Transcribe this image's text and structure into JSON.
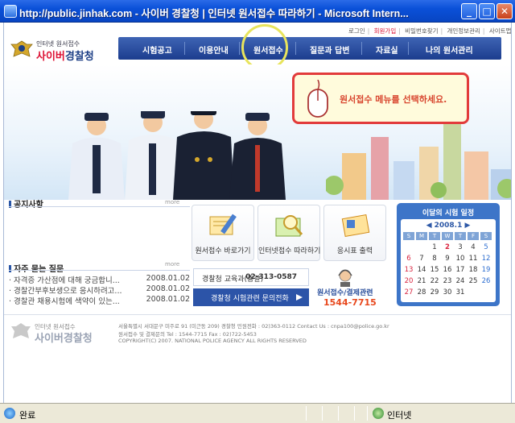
{
  "window": {
    "title": "http://public.jinhak.com - 사이버 경찰청 | 인터넷 원서접수 따라하기 - Microsoft Intern...",
    "minimize": "_",
    "maximize": "□",
    "close": "✕"
  },
  "header": {
    "logo_small": "인터넷 원서접수",
    "logo_big_a": "사이버",
    "logo_big_b": "경찰청",
    "top_links": [
      "로그인",
      "회원가입",
      "비밀번호찾기",
      "개인정보관리",
      "사이트맵"
    ]
  },
  "nav": {
    "items": [
      "시험공고",
      "이용안내",
      "원서접수",
      "질문과 답변",
      "자료실",
      "나의 원서관리"
    ]
  },
  "banner": {
    "callout": "원서접수 메뉴를 선택하세요."
  },
  "notice": {
    "title": "공지사항",
    "more": "more"
  },
  "faq": {
    "title": "자주 묻는 질문",
    "more": "more",
    "items": [
      {
        "text": "· 자격증 가산점에 대해 궁금합니...",
        "date": "2008.01.02"
      },
      {
        "text": "· 경찰간부후보생으로 응시하려고...",
        "date": "2008.01.02"
      },
      {
        "text": "· 경찰관 채용시험에 색약이 있는...",
        "date": "2008.01.02"
      }
    ]
  },
  "services": [
    {
      "label": "원서접수 바로가기"
    },
    {
      "label": "인터넷접수 따라하기"
    },
    {
      "label": "응시표 출력"
    }
  ],
  "contacts": {
    "edu_label": "경찰청 교육과(총괄)",
    "edu_phone": "02-313-0587",
    "inquiry": "경찰청 시험관련 문의전화",
    "payment_label": "원서접수/결제관련",
    "payment_phone": "1544-7715"
  },
  "calendar": {
    "title": "이달의 시험 일정",
    "month": "◀ 2008.1 ▶",
    "weekdays": [
      "S",
      "M",
      "T",
      "W",
      "T",
      "F",
      "S"
    ],
    "weeks": [
      [
        "",
        "",
        "1",
        "2",
        "3",
        "4",
        "5"
      ],
      [
        "6",
        "7",
        "8",
        "9",
        "10",
        "11",
        "12"
      ],
      [
        "13",
        "14",
        "15",
        "16",
        "17",
        "18",
        "19"
      ],
      [
        "20",
        "21",
        "22",
        "23",
        "24",
        "25",
        "26"
      ],
      [
        "27",
        "28",
        "29",
        "30",
        "31",
        "",
        ""
      ]
    ],
    "highlight_day": "2",
    "sunday_color": "#d9243f",
    "saturday_color": "#2f6fd1",
    "highlight_color": "#d9243f"
  },
  "footer": {
    "logo_small": "인터넷 원서접수",
    "logo_big": "사이버경찰청",
    "line1": "서울특별시 서대문구 미주로 91 (미근동 209) 경찰청  민원전화 : 02)363-0112  Contact Us : cnpa100@police.go.kr",
    "line2": "원서접수 및 결제문의 Tel : 1544-7715  Fax : 02)722-5453",
    "line3": "COPYRIGHT(C) 2007. NATIONAL POLICE AGENCY ALL RIGHTS RESERVED"
  },
  "status": {
    "left": "완료",
    "zone": "인터넷"
  }
}
